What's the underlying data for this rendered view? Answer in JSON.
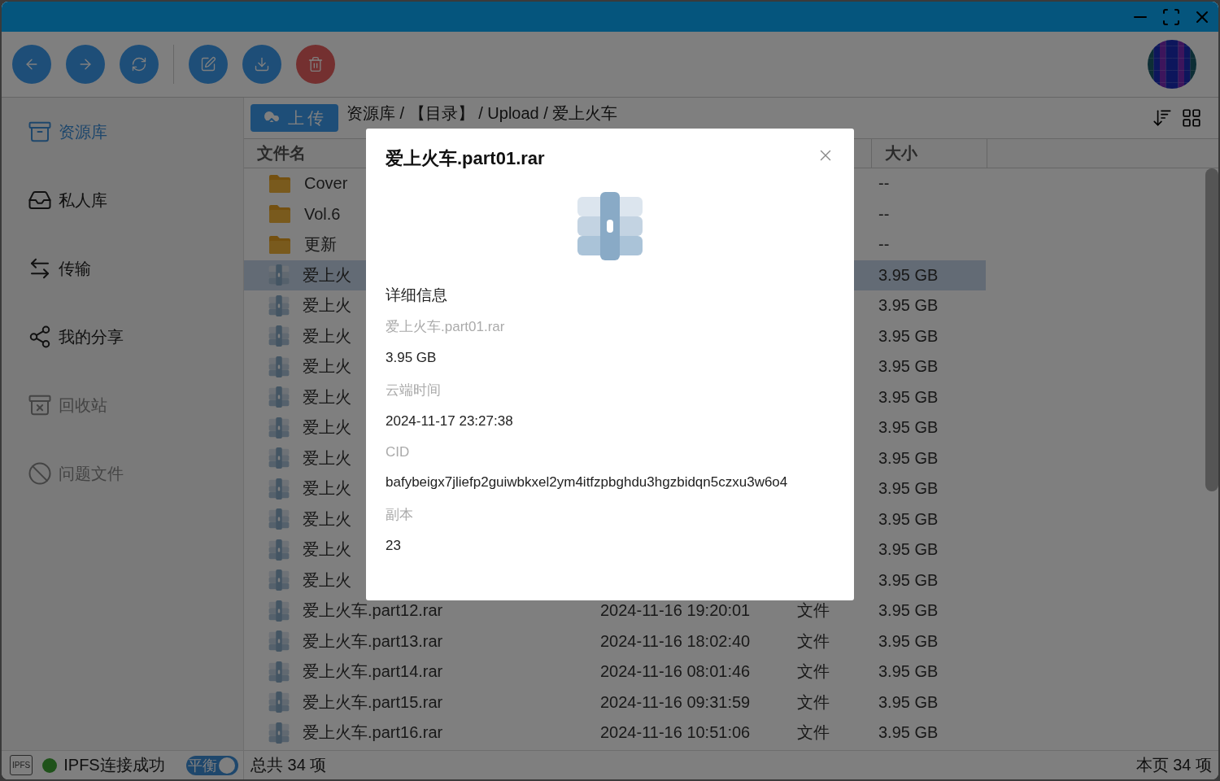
{
  "toolbar": {
    "groups": [
      [
        {
          "kind": "back"
        },
        {
          "kind": "forward"
        },
        {
          "kind": "refresh"
        }
      ],
      [
        {
          "kind": "edit"
        },
        {
          "kind": "download"
        },
        {
          "kind": "delete"
        }
      ]
    ]
  },
  "sidebar": {
    "items": [
      {
        "label": "资源库",
        "kind": "library",
        "selected": true,
        "disabled": false
      },
      {
        "label": "私人库",
        "kind": "private",
        "selected": false,
        "disabled": false
      },
      {
        "label": "传输",
        "kind": "transfer",
        "selected": false,
        "disabled": false
      },
      {
        "label": "我的分享",
        "kind": "share",
        "selected": false,
        "disabled": false
      },
      {
        "label": "回收站",
        "kind": "recycle",
        "selected": false,
        "disabled": true
      },
      {
        "label": "问题文件",
        "kind": "problem",
        "selected": false,
        "disabled": true
      }
    ]
  },
  "main": {
    "upload_button": "上传",
    "breadcrumb": "资源库 / 【目录】 / Upload / 爱上火车"
  },
  "table": {
    "columns": {
      "name": "文件名",
      "size": "大小"
    },
    "rows": [
      {
        "kind": "folder",
        "name": "Cover",
        "size": "--",
        "selected": false
      },
      {
        "kind": "folder",
        "name": "Vol.6",
        "size": "--",
        "selected": false
      },
      {
        "kind": "folder",
        "name": "更新",
        "size": "--",
        "selected": false
      },
      {
        "kind": "archive",
        "name": "爱上火",
        "size": "3.95 GB",
        "selected": true
      },
      {
        "kind": "archive",
        "name": "爱上火",
        "size": "3.95 GB",
        "selected": false
      },
      {
        "kind": "archive",
        "name": "爱上火",
        "size": "3.95 GB",
        "selected": false
      },
      {
        "kind": "archive",
        "name": "爱上火",
        "size": "3.95 GB",
        "selected": false
      },
      {
        "kind": "archive",
        "name": "爱上火",
        "size": "3.95 GB",
        "selected": false
      },
      {
        "kind": "archive",
        "name": "爱上火",
        "size": "3.95 GB",
        "selected": false
      },
      {
        "kind": "archive",
        "name": "爱上火",
        "size": "3.95 GB",
        "selected": false
      },
      {
        "kind": "archive",
        "name": "爱上火",
        "size": "3.95 GB",
        "selected": false
      },
      {
        "kind": "archive",
        "name": "爱上火",
        "size": "3.95 GB",
        "selected": false
      },
      {
        "kind": "archive",
        "name": "爱上火",
        "size": "3.95 GB",
        "selected": false
      },
      {
        "kind": "archive",
        "name": "爱上火",
        "size": "3.95 GB",
        "selected": false
      },
      {
        "kind": "archive",
        "name": "爱上火车.part12.rar",
        "date": "2024-11-16 19:20:01",
        "type": "文件",
        "size": "3.95 GB",
        "selected": false
      },
      {
        "kind": "archive",
        "name": "爱上火车.part13.rar",
        "date": "2024-11-16 18:02:40",
        "type": "文件",
        "size": "3.95 GB",
        "selected": false
      },
      {
        "kind": "archive",
        "name": "爱上火车.part14.rar",
        "date": "2024-11-16 08:01:46",
        "type": "文件",
        "size": "3.95 GB",
        "selected": false
      },
      {
        "kind": "archive",
        "name": "爱上火车.part15.rar",
        "date": "2024-11-16 09:31:59",
        "type": "文件",
        "size": "3.95 GB",
        "selected": false
      },
      {
        "kind": "archive",
        "name": "爱上火车.part16.rar",
        "date": "2024-11-16 10:51:06",
        "type": "文件",
        "size": "3.95 GB",
        "selected": false
      }
    ]
  },
  "status_bar": {
    "ipfs_badge": "IPFS",
    "connection": "IPFS连接成功",
    "mode_toggle": {
      "label": "平衡",
      "on": true
    },
    "total": "总共 34 项",
    "page": "本页 34 项"
  },
  "dialog": {
    "title": "爱上火车.part01.rar",
    "section": "详细信息",
    "fields": [
      {
        "label": "爱上火车.part01.rar",
        "value": "3.95 GB"
      },
      {
        "label": "云端时间",
        "value": "2024-11-17 23:27:38"
      },
      {
        "label": "CID",
        "value": "bafybeigx7jliefp2guiwbkxel2ym4itfzpbghdu3hgzbidqn5czxu3w6o4"
      },
      {
        "label": "副本",
        "value": "23"
      }
    ]
  }
}
